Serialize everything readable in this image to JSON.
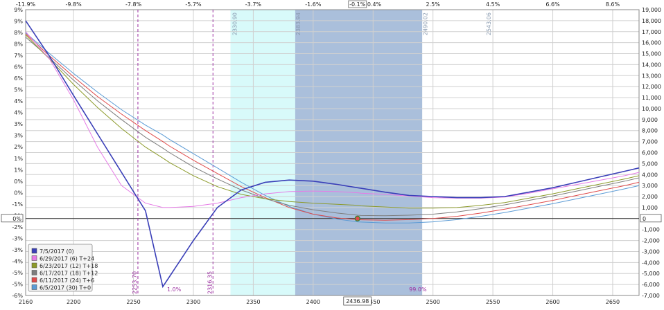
{
  "chart_data": {
    "type": "line",
    "x": [
      2160,
      2180,
      2200,
      2220,
      2240,
      2260,
      2274.5,
      2280,
      2300,
      2320,
      2340,
      2360,
      2380,
      2400,
      2420,
      2436.98,
      2440,
      2460,
      2480,
      2500,
      2520,
      2540,
      2560,
      2580,
      2600,
      2620,
      2640,
      2660,
      2672
    ],
    "xlim": [
      2160,
      2672
    ],
    "ylim": [
      -7000,
      19000
    ],
    "x_ticks": [
      2160,
      2200,
      2250,
      2300,
      2350,
      2400,
      2450,
      2500,
      2550,
      2600,
      2650
    ],
    "top_ticks": [
      "-11.9%",
      "-9.8%",
      "-7.8%",
      "-5.7%",
      "-3.7%",
      "-1.6%",
      "-0.1%",
      "0.4%",
      "2.5%",
      "4.5%",
      "6.6%",
      "8.6%"
    ],
    "left_ticks": [
      "9%",
      "9%",
      "8%",
      "8%",
      "7%",
      "6%",
      "6%",
      "5%",
      "4%",
      "4%",
      "3%",
      "3%",
      "2%",
      "1%",
      "1%",
      "0%",
      "0%",
      "-1%",
      "-1%",
      "-2%",
      "-3%",
      "-3%",
      "-4%",
      "-5%",
      "-5%",
      "-6%"
    ],
    "right_ticks": [
      19000,
      18000,
      17000,
      16000,
      15000,
      14000,
      13000,
      12000,
      11000,
      10000,
      9000,
      8000,
      7000,
      6000,
      5000,
      4000,
      3000,
      2000,
      1000,
      0,
      -1000,
      -2000,
      -3000,
      -4000,
      -5000,
      -6000,
      -7000
    ],
    "right_tick_labels": [
      "19,000",
      "18,000",
      "17,000",
      "16,000",
      "15,000",
      "14,000",
      "13,000",
      "12,000",
      "11,000",
      "10,000",
      "9,000",
      "8,000",
      "7,000",
      "6,000",
      "5,000",
      "4,000",
      "3,000",
      "2,000",
      "1,000",
      "0",
      "-1,000",
      "-2,000",
      "-3,000",
      "-4,000",
      "-5,000",
      "-6,000",
      "-7,000"
    ],
    "left_zero_label": "0%",
    "right_zero_label": "0",
    "current_x": 2436.98,
    "current_x_label": "2436.98",
    "current_pct_label": "-0.1%",
    "series": [
      {
        "name": "7/5/2017 (0)",
        "color": "#3a3fb8",
        "values": [
          18000,
          14750,
          11200,
          7700,
          4200,
          700,
          -6200,
          -5300,
          -2000,
          1000,
          2600,
          3300,
          3500,
          3400,
          3100,
          2800,
          2750,
          2400,
          2100,
          2000,
          1900,
          1900,
          2000,
          2400,
          2800,
          3300,
          3800,
          4300,
          4600
        ]
      },
      {
        "name": "6/29/2017 (6) T+24",
        "color": "#e67be6",
        "values": [
          17000,
          14500,
          10800,
          6500,
          3000,
          1400,
          1000,
          1000,
          1100,
          1400,
          1900,
          2250,
          2450,
          2500,
          2450,
          2350,
          2300,
          2200,
          2050,
          1900,
          1850,
          1850,
          1950,
          2300,
          2700,
          3100,
          3500,
          3900,
          4200
        ]
      },
      {
        "name": "6/23/2017 (12) T+18",
        "color": "#8c9a2a",
        "values": [
          16700,
          14500,
          12200,
          10100,
          8200,
          6500,
          5500,
          5100,
          3900,
          2900,
          2200,
          1800,
          1550,
          1400,
          1300,
          1200,
          1150,
          1050,
          950,
          950,
          1000,
          1200,
          1450,
          1850,
          2250,
          2700,
          3150,
          3600,
          3900
        ]
      },
      {
        "name": "6/17/2017 (18) T+12",
        "color": "#7d7d7d",
        "values": [
          16500,
          14600,
          12600,
          10700,
          9000,
          7400,
          6400,
          6000,
          4700,
          3600,
          2600,
          1800,
          1200,
          800,
          500,
          300,
          280,
          250,
          300,
          400,
          600,
          900,
          1250,
          1650,
          2050,
          2500,
          2950,
          3400,
          3700
        ]
      },
      {
        "name": "6/11/2017 (24) T+6",
        "color": "#e04a4a",
        "values": [
          16800,
          14800,
          12900,
          11100,
          9500,
          8000,
          7000,
          6600,
          5300,
          4100,
          2900,
          1900,
          1000,
          400,
          50,
          -100,
          -110,
          -150,
          -100,
          0,
          200,
          500,
          850,
          1250,
          1650,
          2100,
          2550,
          3000,
          3300
        ]
      },
      {
        "name": "6/5/2017 (30) T+0",
        "color": "#5b9bd5",
        "values": [
          16900,
          15000,
          13200,
          11500,
          9900,
          8500,
          7600,
          7200,
          5900,
          4600,
          3300,
          2100,
          1100,
          400,
          -50,
          -300,
          -320,
          -400,
          -400,
          -300,
          -100,
          200,
          550,
          950,
          1350,
          1800,
          2250,
          2700,
          3000
        ]
      }
    ],
    "outer_band": [
      2331,
      2444
    ],
    "inner_band": [
      2385,
      2491
    ],
    "band_labels": [
      {
        "x": 2330.9,
        "text": "2330.90"
      },
      {
        "x": 2383.94,
        "text": "2383.94"
      },
      {
        "x": 2490.02,
        "text": "2490.02"
      },
      {
        "x": 2543.06,
        "text": "2543.06"
      }
    ],
    "breakevens": [
      {
        "x": 2253.7,
        "text": "2253.70"
      },
      {
        "x": 2316.35,
        "text": "2316.35"
      }
    ],
    "annotations": [
      {
        "x": 2278,
        "text": "1.0%"
      },
      {
        "x": 2480,
        "text": "99.0%"
      }
    ]
  }
}
